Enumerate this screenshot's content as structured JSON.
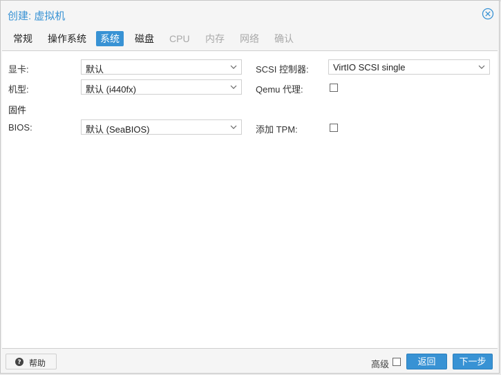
{
  "window": {
    "title": "创建: 虚拟机"
  },
  "tabs": [
    {
      "label": "常规",
      "state": "normal"
    },
    {
      "label": "操作系统",
      "state": "normal"
    },
    {
      "label": "系统",
      "state": "active"
    },
    {
      "label": "磁盘",
      "state": "normal"
    },
    {
      "label": "CPU",
      "state": "disabled"
    },
    {
      "label": "内存",
      "state": "disabled"
    },
    {
      "label": "网络",
      "state": "disabled"
    },
    {
      "label": "确认",
      "state": "disabled"
    }
  ],
  "form": {
    "graphics_label": "显卡:",
    "graphics_value": "默认",
    "machine_label": "机型:",
    "machine_value": "默认 (i440fx)",
    "firmware_section": "固件",
    "bios_label": "BIOS:",
    "bios_value": "默认 (SeaBIOS)",
    "scsi_label": "SCSI 控制器:",
    "scsi_value": "VirtIO SCSI single",
    "qemu_agent_label": "Qemu 代理:",
    "tpm_label": "添加 TPM:"
  },
  "footer": {
    "help_label": "帮助",
    "advanced_label": "高级",
    "back_label": "返回",
    "next_label": "下一步"
  },
  "colors": {
    "accent": "#3892d4",
    "disabled_text": "#a9a9a9"
  }
}
